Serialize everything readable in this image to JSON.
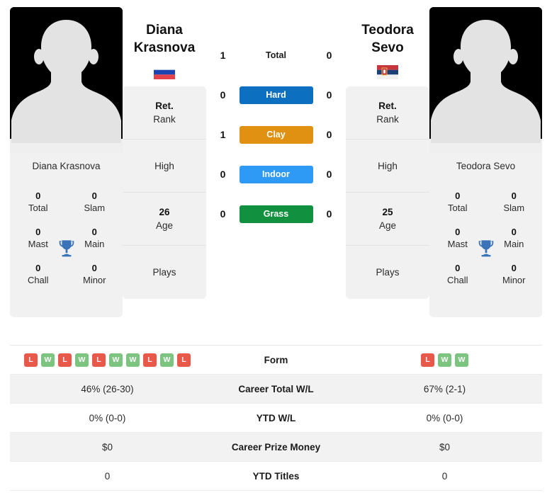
{
  "players": {
    "left": {
      "first_name": "Diana",
      "last_name": "Krasnova",
      "full_name": "Diana Krasnova",
      "country": "Russia",
      "flag_icon": "russia-flag",
      "age": "26",
      "rank_value": "Ret.",
      "rank_label": "Rank",
      "high_value": "",
      "high_label": "High",
      "age_label": "Age",
      "plays_value": "",
      "plays_label": "Plays",
      "titles": [
        {
          "value": "0",
          "label": "Total"
        },
        {
          "value": "0",
          "label": "Slam"
        },
        {
          "value": "0",
          "label": "Mast"
        },
        {
          "value": "0",
          "label": "Main"
        },
        {
          "value": "0",
          "label": "Chall"
        },
        {
          "value": "0",
          "label": "Minor"
        }
      ],
      "form": [
        "L",
        "W",
        "L",
        "W",
        "L",
        "W",
        "W",
        "L",
        "W",
        "L"
      ],
      "career_total_wl": "46% (26-30)",
      "ytd_wl": "0% (0-0)",
      "career_prize_money": "$0",
      "ytd_titles": "0"
    },
    "right": {
      "first_name": "Teodora",
      "last_name": "Sevo",
      "full_name": "Teodora Sevo",
      "country": "Serbia",
      "flag_icon": "serbia-flag",
      "age": "25",
      "rank_value": "Ret.",
      "rank_label": "Rank",
      "high_value": "",
      "high_label": "High",
      "age_label": "Age",
      "plays_value": "",
      "plays_label": "Plays",
      "titles": [
        {
          "value": "0",
          "label": "Total"
        },
        {
          "value": "0",
          "label": "Slam"
        },
        {
          "value": "0",
          "label": "Mast"
        },
        {
          "value": "0",
          "label": "Main"
        },
        {
          "value": "0",
          "label": "Chall"
        },
        {
          "value": "0",
          "label": "Minor"
        }
      ],
      "form": [
        "L",
        "W",
        "W"
      ],
      "career_total_wl": "67% (2-1)",
      "ytd_wl": "0% (0-0)",
      "career_prize_money": "$0",
      "ytd_titles": "0"
    }
  },
  "head_to_head": [
    {
      "label": "Total",
      "left": "1",
      "right": "0",
      "type": "plain",
      "color": ""
    },
    {
      "label": "Hard",
      "left": "0",
      "right": "0",
      "type": "badge",
      "color": "#0d6fc0"
    },
    {
      "label": "Clay",
      "left": "1",
      "right": "0",
      "type": "badge",
      "color": "#e09112"
    },
    {
      "label": "Indoor",
      "left": "0",
      "right": "0",
      "type": "badge",
      "color": "#2f9af5"
    },
    {
      "label": "Grass",
      "left": "0",
      "right": "0",
      "type": "badge",
      "color": "#119140"
    }
  ],
  "stats_rows": [
    {
      "label": "Form",
      "left": "",
      "right": "",
      "kind": "form"
    },
    {
      "label": "Career Total W/L",
      "left": "46% (26-30)",
      "right": "67% (2-1)",
      "kind": "text"
    },
    {
      "label": "YTD W/L",
      "left": "0% (0-0)",
      "right": "0% (0-0)",
      "kind": "text"
    },
    {
      "label": "Career Prize Money",
      "left": "$0",
      "right": "$0",
      "kind": "text"
    },
    {
      "label": "YTD Titles",
      "left": "0",
      "right": "0",
      "kind": "text"
    }
  ],
  "colors": {
    "win_badge": "#7cc47f",
    "loss_badge": "#e8594a",
    "trophy": "#3b73b9",
    "card_bg": "#f1f1f1",
    "row_alt_bg": "#f2f2f2"
  }
}
